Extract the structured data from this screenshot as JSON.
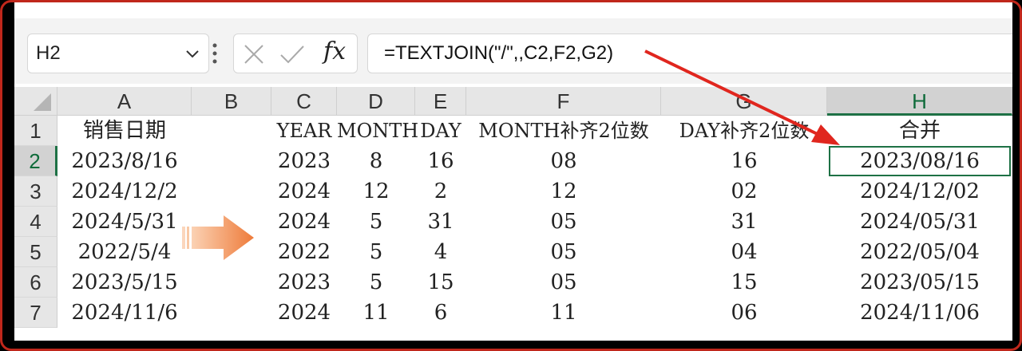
{
  "namebox": {
    "value": "H2"
  },
  "formula": {
    "fx_label": "fx",
    "text": "=TEXTJOIN(\"/\",,C2,F2,G2)"
  },
  "columns": [
    "A",
    "B",
    "C",
    "D",
    "E",
    "F",
    "G",
    "H"
  ],
  "rows": [
    "1",
    "2",
    "3",
    "4",
    "5",
    "6",
    "7"
  ],
  "selected_cell": "H2",
  "table": {
    "headers": {
      "A": "销售日期",
      "B": "",
      "C": "YEAR",
      "D": "MONTH",
      "E": "DAY",
      "F": "MONTH补齐2位数",
      "G": "DAY补齐2位数",
      "H": "合并"
    },
    "data": [
      {
        "A": "2023/8/16",
        "C": "2023",
        "D": "8",
        "E": "16",
        "F": "08",
        "G": "16",
        "H": "2023/08/16"
      },
      {
        "A": "2024/12/2",
        "C": "2024",
        "D": "12",
        "E": "2",
        "F": "12",
        "G": "02",
        "H": "2024/12/02"
      },
      {
        "A": "2024/5/31",
        "C": "2024",
        "D": "5",
        "E": "31",
        "F": "05",
        "G": "31",
        "H": "2024/05/31"
      },
      {
        "A": "2022/5/4",
        "C": "2022",
        "D": "5",
        "E": "4",
        "F": "05",
        "G": "04",
        "H": "2022/05/04"
      },
      {
        "A": "2023/5/15",
        "C": "2023",
        "D": "5",
        "E": "15",
        "F": "05",
        "G": "15",
        "H": "2023/05/15"
      },
      {
        "A": "2024/11/6",
        "C": "2024",
        "D": "11",
        "E": "6",
        "F": "11",
        "G": "06",
        "H": "2024/11/06"
      }
    ]
  },
  "colors": {
    "frame": "#c0271b",
    "selection": "#1e7145",
    "arrow_red": "#e0261e",
    "arrow_orange": "#f08a4b"
  }
}
